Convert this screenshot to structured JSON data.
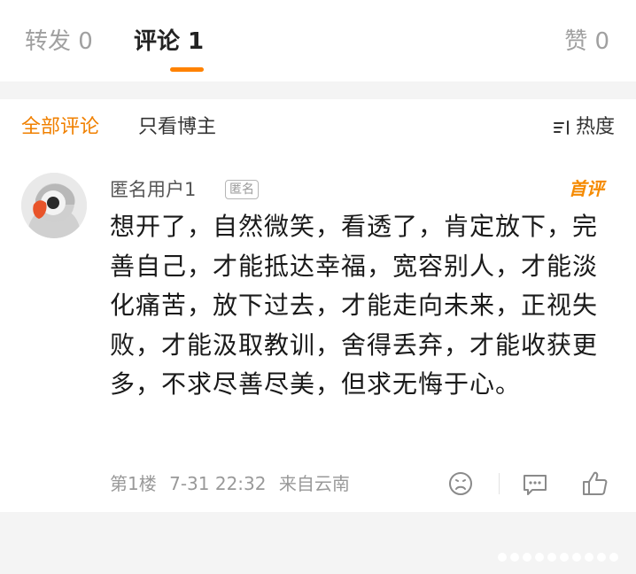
{
  "tabs": {
    "forward": "转发 0",
    "comment": "评论 1",
    "like": "赞 0"
  },
  "filter": {
    "all": "全部评论",
    "owner_only": "只看博主",
    "sort": "热度"
  },
  "comment": {
    "username": "匿名用户1",
    "anon_badge": "匿名",
    "first_badge": "首评",
    "text": "想开了，自然微笑，看透了，肯定放下，完善自己，才能抵达幸福，宽容别人，才能淡化痛苦，放下过去，才能走向未来，正视失败，才能汲取教训，舍得丢弃，才能收获更多，不求尽善尽美，但求无悔于心。",
    "floor": "第1楼",
    "time": "7-31 22:32",
    "location": "来自云南"
  },
  "icons": {
    "sort": "sort-icon",
    "dislike": "frown-icon",
    "reply": "comment-bubble-icon",
    "like": "thumbs-up-icon"
  },
  "colors": {
    "accent": "#ff8200",
    "filter_active": "#f08000",
    "first_badge": "#f58a00"
  }
}
